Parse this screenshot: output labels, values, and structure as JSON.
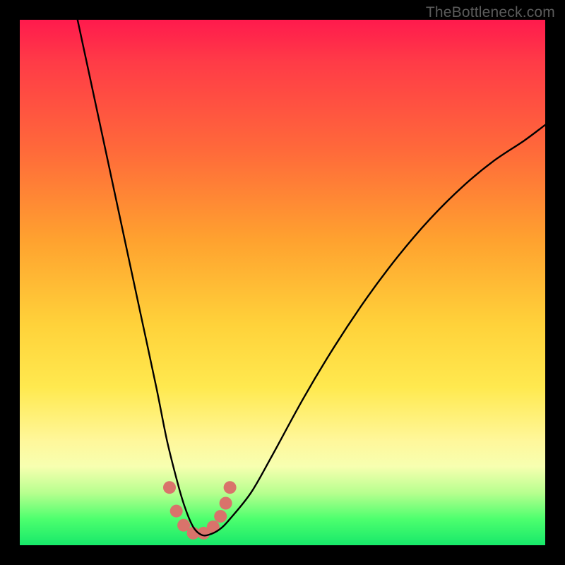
{
  "watermark": "TheBottleneck.com",
  "chart_data": {
    "type": "line",
    "title": "",
    "xlabel": "",
    "ylabel": "",
    "xlim": [
      0,
      100
    ],
    "ylim": [
      0,
      100
    ],
    "grid": false,
    "legend": false,
    "series": [
      {
        "name": "bottleneck-curve",
        "x": [
          11,
          14,
          17,
          20,
          23,
          26,
          28,
          30,
          31.5,
          33,
          34.5,
          36,
          38,
          40,
          44,
          48,
          54,
          60,
          66,
          72,
          78,
          84,
          90,
          96,
          100
        ],
        "values": [
          100,
          86,
          72,
          58,
          44,
          30,
          20,
          12,
          7,
          3.5,
          2,
          2,
          3,
          5,
          10,
          17,
          28,
          38,
          47,
          55,
          62,
          68,
          73,
          77,
          80
        ]
      },
      {
        "name": "trough-markers",
        "type": "scatter",
        "x": [
          28.5,
          29.8,
          31.2,
          33.0,
          35.0,
          36.8,
          38.2,
          39.2,
          40.0
        ],
        "values": [
          11.0,
          6.5,
          3.8,
          2.3,
          2.3,
          3.5,
          5.5,
          8.0,
          11.0
        ]
      }
    ],
    "colors": {
      "curve": "#000000",
      "markers": "#d9736b",
      "gradient_top": "#ff1a4d",
      "gradient_mid": "#ffe94f",
      "gradient_bottom": "#17e86a"
    }
  }
}
